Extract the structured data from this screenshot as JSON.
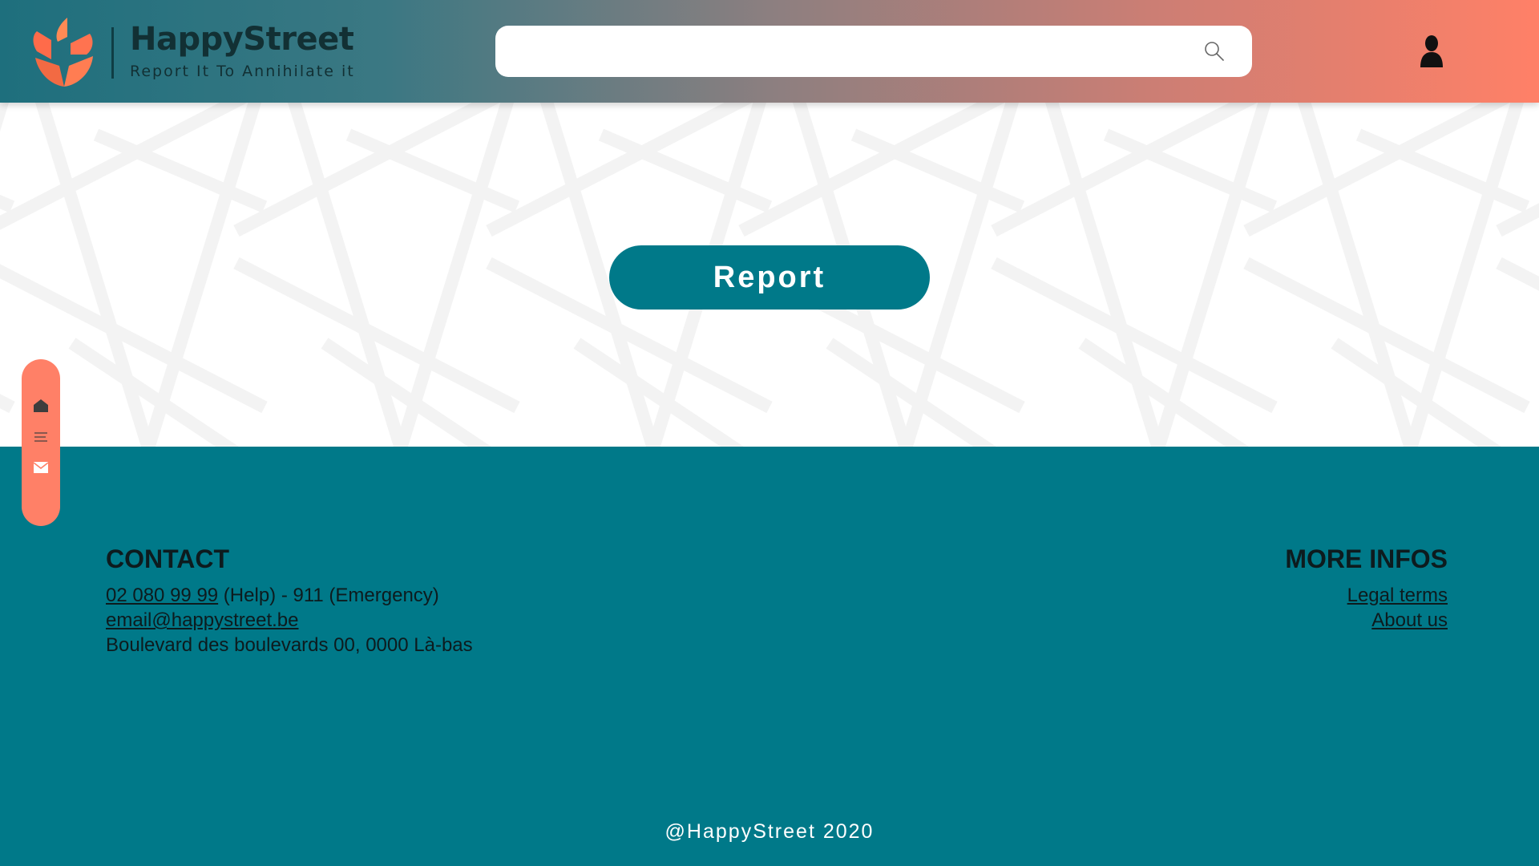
{
  "brand": {
    "name": "HappyStreet",
    "tagline": "Report It To Annihilate it"
  },
  "search": {
    "value": "",
    "placeholder": ""
  },
  "hero": {
    "report_label": "Report"
  },
  "side_dock": {
    "items": [
      {
        "icon": "home-icon"
      },
      {
        "icon": "menu-icon"
      },
      {
        "icon": "mail-icon"
      }
    ]
  },
  "footer": {
    "contact": {
      "title": "CONTACT",
      "phone": "02 080 99 99",
      "phone_suffix": " (Help) - 911 (Emergency)",
      "email": "email@happystreet.be",
      "address": "Boulevard des boulevards 00, 0000 Là-bas"
    },
    "more": {
      "title": "MORE INFOS",
      "links": [
        "Legal terms",
        "About us"
      ]
    },
    "copyright": "@HappyStreet 2020"
  },
  "colors": {
    "teal": "#007989",
    "coral": "#ff8067",
    "dark_text": "#0d1b1e"
  }
}
